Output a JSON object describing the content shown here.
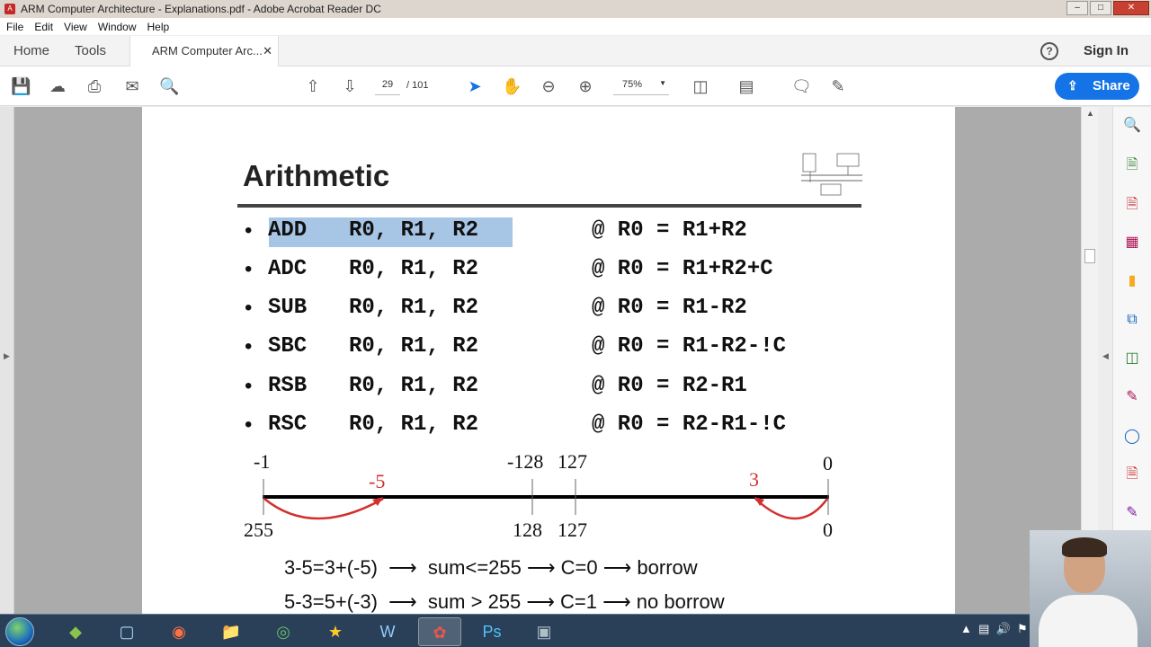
{
  "window": {
    "title": "ARM Computer Architecture - Explanations.pdf - Adobe Acrobat Reader DC"
  },
  "menu": [
    "File",
    "Edit",
    "View",
    "Window",
    "Help"
  ],
  "tabs": {
    "home": "Home",
    "tools": "Tools",
    "doc": "ARM Computer Arc..."
  },
  "header": {
    "signin": "Sign In"
  },
  "toolbar": {
    "page_current": "29",
    "page_total": "/ 101",
    "zoom": "75%",
    "share": "Share"
  },
  "slide": {
    "title": "Arithmetic",
    "instructions": [
      {
        "op": "ADD",
        "args": "R0, R1, R2",
        "comment": "@ R0 = R1+R2"
      },
      {
        "op": "ADC",
        "args": "R0, R1, R2",
        "comment": "@ R0 = R1+R2+C"
      },
      {
        "op": "SUB",
        "args": "R0, R1, R2",
        "comment": "@ R0 = R1-R2"
      },
      {
        "op": "SBC",
        "args": "R0, R1, R2",
        "comment": "@ R0 = R1-R2-!C"
      },
      {
        "op": "RSB",
        "args": "R0, R1, R2",
        "comment": "@ R0 = R2-R1"
      },
      {
        "op": "RSC",
        "args": "R0, R1, R2",
        "comment": "@ R0 = R2-R1-!C"
      }
    ],
    "numberline": {
      "top_labels": [
        "-1",
        "-128",
        "127",
        "0"
      ],
      "bottom_labels": [
        "255",
        "128",
        "127",
        "0"
      ],
      "red_labels": [
        "-5",
        "3"
      ]
    },
    "examples": [
      "3-5=3+(-5)  ⟶  sum<=255 ⟶ C=0 ⟶ borrow",
      "5-3=5+(-3)  ⟶  sum > 255 ⟶ C=1 ⟶ no borrow"
    ]
  },
  "colors": {
    "accent": "#1473e6",
    "selection": "#a7c6e6",
    "red": "#d32f2f"
  }
}
